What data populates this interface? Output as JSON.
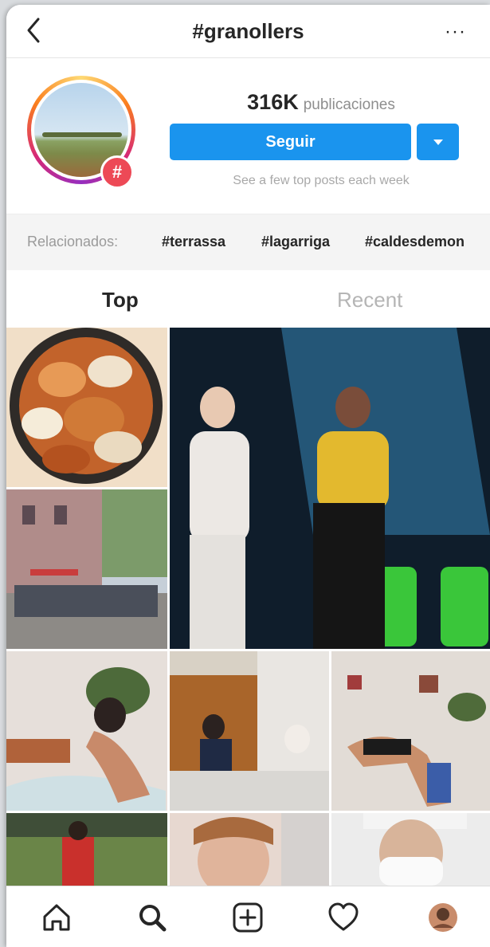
{
  "header": {
    "title": "#granollers",
    "more_label": "···"
  },
  "profile": {
    "post_count": "316K",
    "post_count_label": "publicaciones",
    "follow_label": "Seguir",
    "hint": "See a few top posts each week",
    "badge_symbol": "#"
  },
  "related": {
    "label": "Relacionados:",
    "tags": [
      "#terrassa",
      "#lagarriga",
      "#caldesdemon"
    ]
  },
  "tabs": {
    "top": "Top",
    "recent": "Recent",
    "active": "top"
  },
  "colors": {
    "accent": "#1a94ee",
    "badge": "#ed4956"
  },
  "bottom_nav": [
    "home-icon",
    "search-icon",
    "add-post-icon",
    "heart-icon",
    "profile-avatar"
  ]
}
